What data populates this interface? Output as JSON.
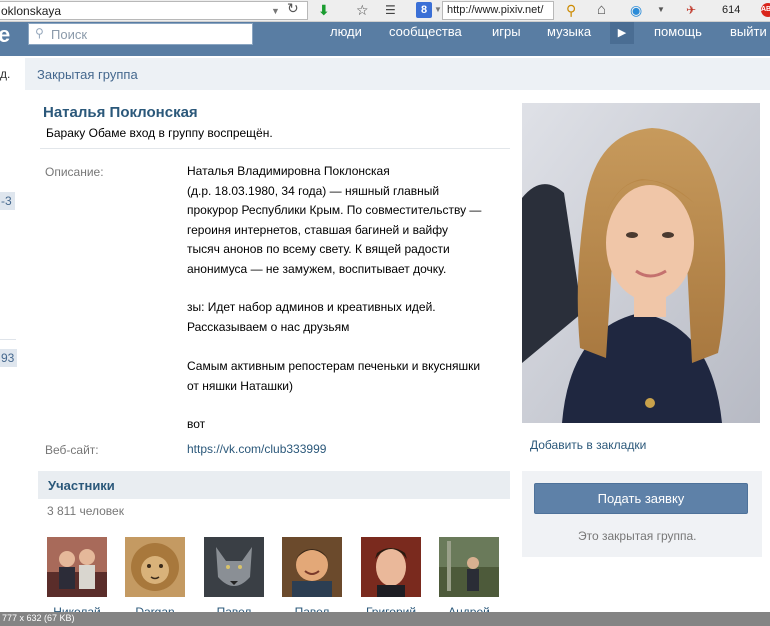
{
  "browser": {
    "address_text": "oklonskaya",
    "search_url": "http://www.pixiv.net/",
    "search_engine_letter": "8",
    "badge_count": "614",
    "abp_label": "ABP"
  },
  "vk_header": {
    "logo_fragment": "e",
    "search_placeholder": "Поиск",
    "nav": {
      "people": "люди",
      "communities": "сообщества",
      "games": "игры",
      "music": "музыка",
      "play": "▶",
      "help": "помощь",
      "exit": "выйти"
    }
  },
  "sidebar": {
    "fragment_top": "д.",
    "fragment_counter1": "-3",
    "fragment_counter2": "93"
  },
  "group": {
    "section_title": "Закрытая группа",
    "name": "Наталья Поклонская",
    "status": "Бараку Обаме вход в группу воспрещён.",
    "description_label": "Описание:",
    "description_p1": "Наталья Владимировна Поклонская\n(д.р. 18.03.1980, 34 года) — няшный главный\nпрокурор Республики Крым. По совместительству —\nгероиня интернетов, ставшая багиней и вайфу\nтысяч анонов по всему свету. К вящей радости\nанонимуса — не замужем, воспитывает дочку.",
    "description_p2": "зы: Идет набор админов и креативных идей.\nРассказываем о нас друзьям",
    "description_p3": "Самым активным репостерам печеньки и вкусняшки\nот няшки Наташки)",
    "description_p4": "вот",
    "website_label": "Веб-сайт:",
    "website_url": "https://vk.com/club333999",
    "add_bookmark": "Добавить в закладки",
    "join_button": "Подать заявку",
    "closed_note": "Это закрытая группа."
  },
  "members": {
    "title": "Участники",
    "count": "3 811 человек",
    "list": [
      {
        "name": "Николай"
      },
      {
        "name": "Dargan"
      },
      {
        "name": "Павел"
      },
      {
        "name": "Павел"
      },
      {
        "name": "Григорий"
      },
      {
        "name": "Андрей"
      }
    ]
  },
  "status_strip": {
    "text": "777 x 632 (67 KB)"
  },
  "colors": {
    "vk_header": "#597da3",
    "link": "#2b587a",
    "join_button": "#5e81a8"
  }
}
